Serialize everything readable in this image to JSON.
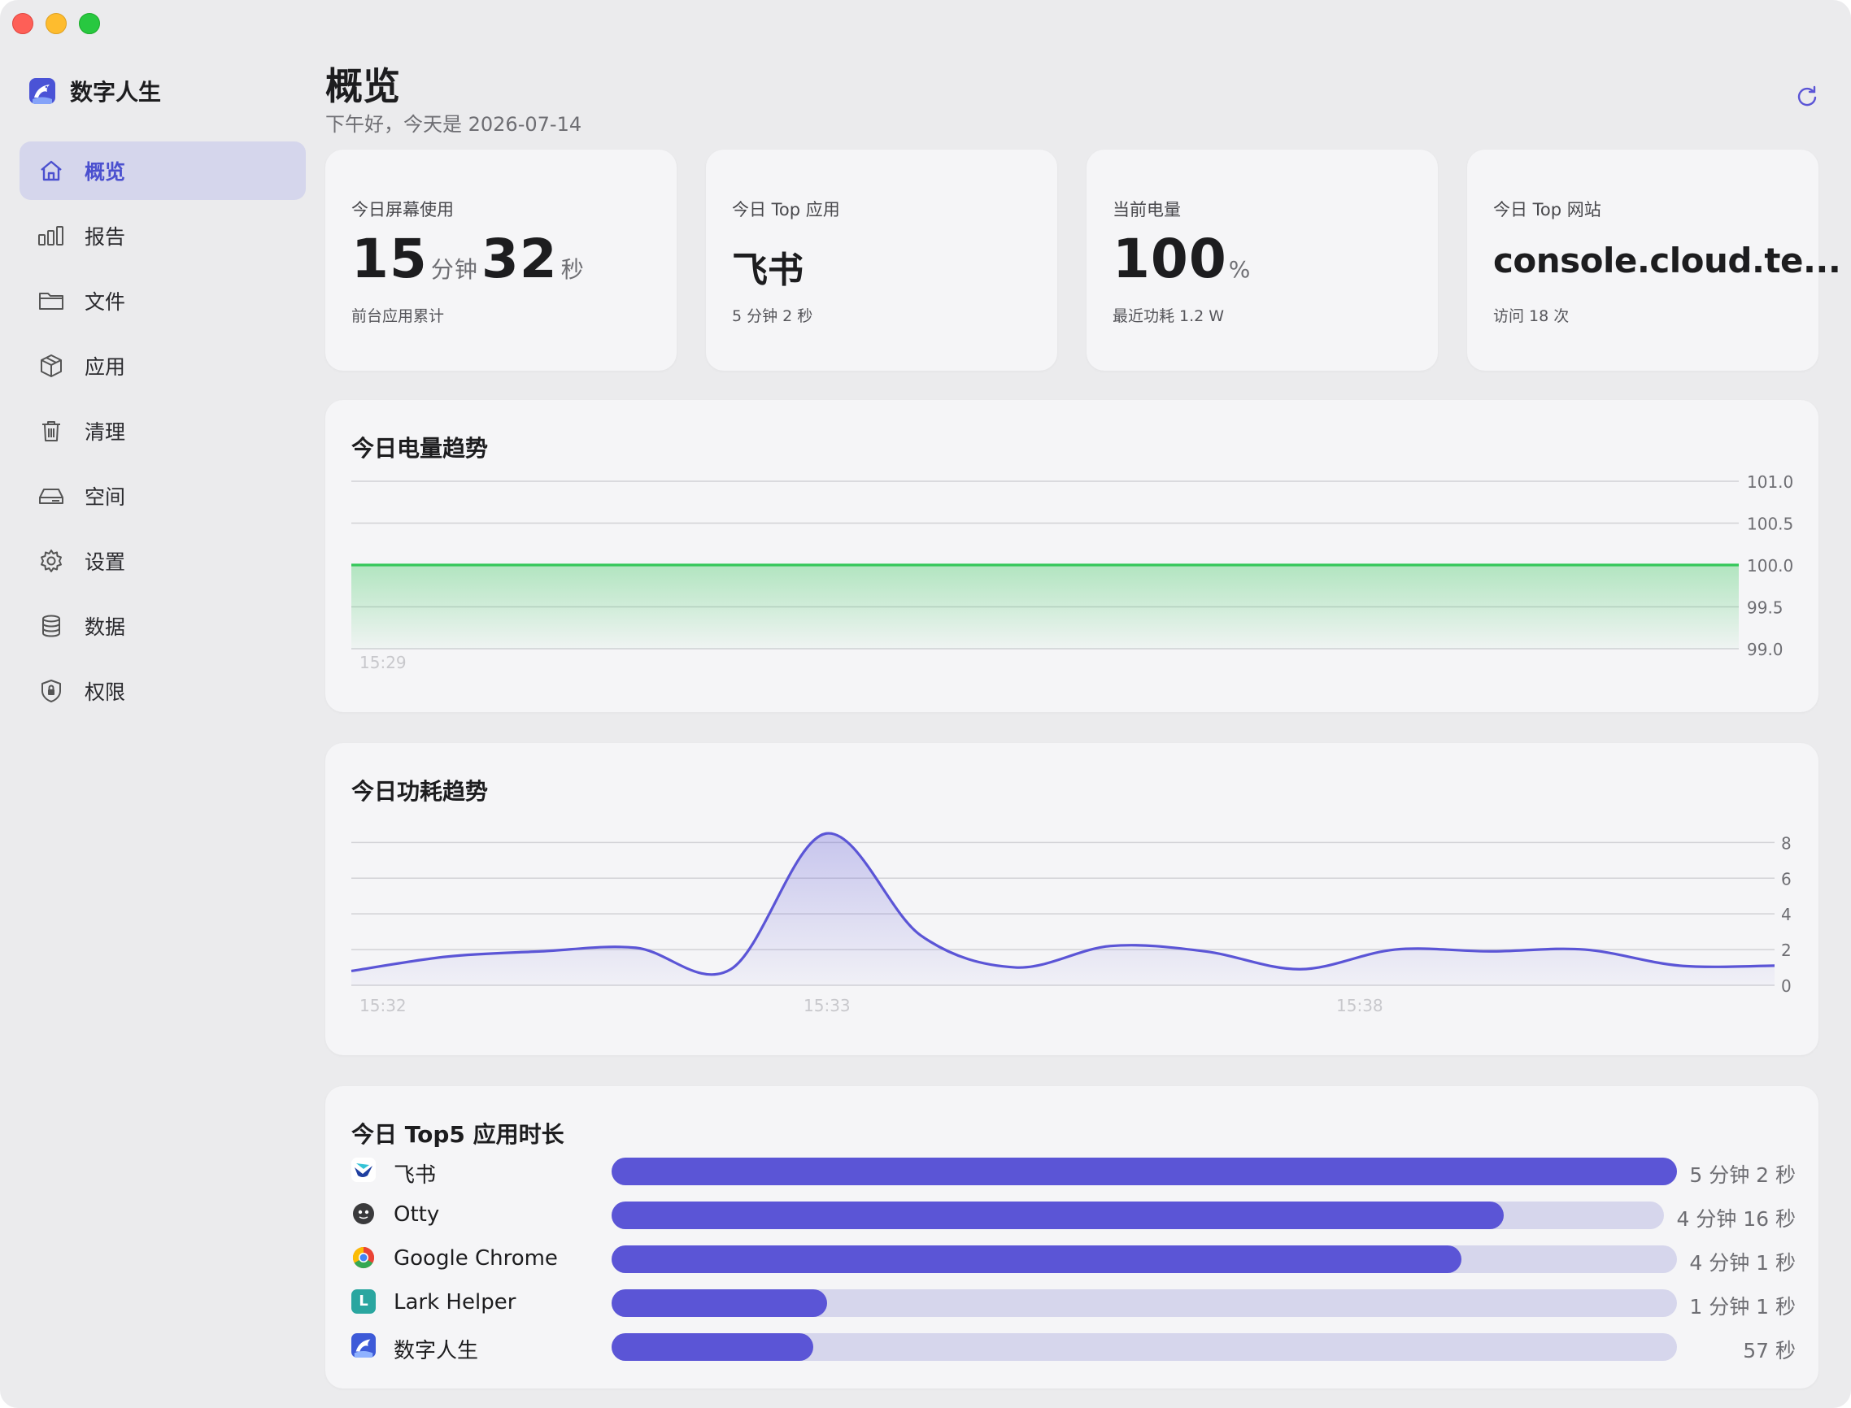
{
  "sidebar": {
    "brand": "数字人生",
    "items": [
      {
        "label": "概览",
        "icon": "home-icon",
        "active": true
      },
      {
        "label": "报告",
        "icon": "bar-chart-icon"
      },
      {
        "label": "文件",
        "icon": "folder-icon"
      },
      {
        "label": "应用",
        "icon": "cube-icon"
      },
      {
        "label": "清理",
        "icon": "trash-icon"
      },
      {
        "label": "空间",
        "icon": "disk-icon"
      },
      {
        "label": "设置",
        "icon": "gear-icon"
      },
      {
        "label": "数据",
        "icon": "database-icon"
      },
      {
        "label": "权限",
        "icon": "shield-icon"
      }
    ]
  },
  "header": {
    "title": "概览",
    "subtitle": "下午好，今天是 2026-07-14",
    "refresh_icon": "refresh-icon"
  },
  "stats": {
    "screen": {
      "label": "今日屏幕使用",
      "minutes": "15",
      "minutes_unit": "分钟",
      "seconds": "32",
      "seconds_unit": "秒",
      "sub": "前台应用累计"
    },
    "top_app": {
      "label": "今日 Top 应用",
      "value": "飞书",
      "sub": "5 分钟 2 秒"
    },
    "battery": {
      "label": "当前电量",
      "value": "100",
      "unit": "%",
      "sub": "最近功耗 1.2 W"
    },
    "top_site": {
      "label": "今日 Top 网站",
      "value": "console.cloud.te...",
      "sub": "访问 18 次"
    }
  },
  "battery_trend": {
    "title": "今日电量趋势",
    "chart_data": {
      "type": "area",
      "x": [
        "15:29"
      ],
      "series": [
        {
          "values": [
            100.0,
            100.0
          ]
        }
      ],
      "yticks": [
        "101.0",
        "100.5",
        "100.0",
        "99.5",
        "99.0"
      ],
      "ylim": [
        99.0,
        101.0
      ],
      "xticks": [
        "15:29"
      ],
      "color": "#34c759"
    }
  },
  "power_trend": {
    "title": "今日功耗趋势",
    "chart_data": {
      "type": "area",
      "xticks": [
        "15:32",
        "15:33",
        "15:38"
      ],
      "series": [
        {
          "values": [
            0.8,
            1.6,
            1.9,
            2.1,
            0.9,
            8.5,
            2.8,
            1.0,
            2.2,
            1.9,
            0.9,
            2.0,
            1.9,
            2.0,
            1.1,
            1.1
          ]
        }
      ],
      "yticks": [
        "8",
        "6",
        "4",
        "2",
        "0"
      ],
      "ylim": [
        0,
        9.2
      ],
      "color": "#5b55d6"
    }
  },
  "top5": {
    "title": "今日 Top5 应用时长",
    "chart_data": {
      "type": "bar",
      "categories": [
        "飞书",
        "Otty",
        "Google Chrome",
        "Lark Helper",
        "数字人生"
      ],
      "values_seconds": [
        302,
        256,
        241,
        61,
        57
      ],
      "labels": [
        "5 分钟 2 秒",
        "4 分钟 16 秒",
        "4 分钟 1 秒",
        "1 分钟 1 秒",
        "57 秒"
      ]
    },
    "apps": [
      {
        "name": "飞书",
        "time": "5 分钟 2 秒",
        "fraction": 1.0,
        "icon": "feishu-icon"
      },
      {
        "name": "Otty",
        "time": "4 分钟 16 秒",
        "fraction": 0.848,
        "icon": "otty-icon"
      },
      {
        "name": "Google Chrome",
        "time": "4 分钟 1 秒",
        "fraction": 0.798,
        "icon": "chrome-icon"
      },
      {
        "name": "Lark Helper",
        "time": "1 分钟 1 秒",
        "fraction": 0.202,
        "icon": "lark-helper-icon",
        "letter": "L"
      },
      {
        "name": "数字人生",
        "time": "57 秒",
        "fraction": 0.189,
        "icon": "app-logo-icon"
      }
    ]
  }
}
